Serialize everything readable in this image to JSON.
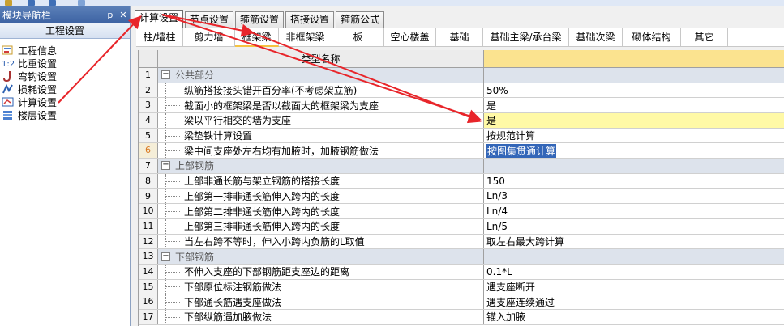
{
  "nav": {
    "title": "模块导航栏",
    "pin_glyph": "ᵽ",
    "close_glyph": "✕",
    "group": "工程设置",
    "items": [
      {
        "label": "工程信息",
        "icon": "info-icon"
      },
      {
        "label": "比重设置",
        "icon": "weight-icon"
      },
      {
        "label": "弯钩设置",
        "icon": "hook-icon"
      },
      {
        "label": "损耗设置",
        "icon": "loss-icon"
      },
      {
        "label": "计算设置",
        "icon": "calc-icon"
      },
      {
        "label": "楼层设置",
        "icon": "floor-icon"
      }
    ]
  },
  "tabs_main": [
    "计算设置",
    "节点设置",
    "箍筋设置",
    "搭接设置",
    "箍筋公式"
  ],
  "tabs_sub": [
    "柱/墙柱",
    "剪力墙",
    "框架梁",
    "非框架梁",
    "板",
    "空心楼盖",
    "基础",
    "基础主梁/承台梁",
    "基础次梁",
    "砌体结构",
    "其它"
  ],
  "grid": {
    "header_name": "类型名称",
    "rows": [
      {
        "n": "1",
        "name": "公共部分",
        "value": "",
        "group": true
      },
      {
        "n": "2",
        "name": "纵筋搭接接头错开百分率(不考虑架立筋)",
        "value": "50%"
      },
      {
        "n": "3",
        "name": "截面小的框架梁是否以截面大的框架梁为支座",
        "value": "是"
      },
      {
        "n": "4",
        "name": "梁以平行相交的墙为支座",
        "value": "是"
      },
      {
        "n": "5",
        "name": "梁垫铁计算设置",
        "value": "按规范计算"
      },
      {
        "n": "6",
        "name": "梁中间支座处左右均有加腋时，加腋钢筋做法",
        "value": "按图集贯通计算"
      },
      {
        "n": "7",
        "name": "上部钢筋",
        "value": "",
        "group": true
      },
      {
        "n": "8",
        "name": "上部非通长筋与架立钢筋的搭接长度",
        "value": "150"
      },
      {
        "n": "9",
        "name": "上部第一排非通长筋伸入跨内的长度",
        "value": "Ln/3"
      },
      {
        "n": "10",
        "name": "上部第二排非通长筋伸入跨内的长度",
        "value": "Ln/4"
      },
      {
        "n": "11",
        "name": "上部第三排非通长筋伸入跨内的长度",
        "value": "Ln/5"
      },
      {
        "n": "12",
        "name": "当左右跨不等时，伸入小跨内负筋的L取值",
        "value": "取左右最大跨计算"
      },
      {
        "n": "13",
        "name": "下部钢筋",
        "value": "",
        "group": true
      },
      {
        "n": "14",
        "name": "不伸入支座的下部钢筋距支座边的距离",
        "value": "0.1*L"
      },
      {
        "n": "15",
        "name": "下部原位标注钢筋做法",
        "value": "遇支座断开"
      },
      {
        "n": "16",
        "name": "下部通长筋遇支座做法",
        "value": "遇支座连续通过"
      },
      {
        "n": "17",
        "name": "下部纵筋遇加腋做法",
        "value": "锚入加腋"
      }
    ]
  },
  "colors": {
    "annotation": "#e8252a",
    "header_value_bg": "#fbe38f",
    "selected_value_bg": "#fff9a6",
    "highlight_bg": "#3366b8"
  }
}
